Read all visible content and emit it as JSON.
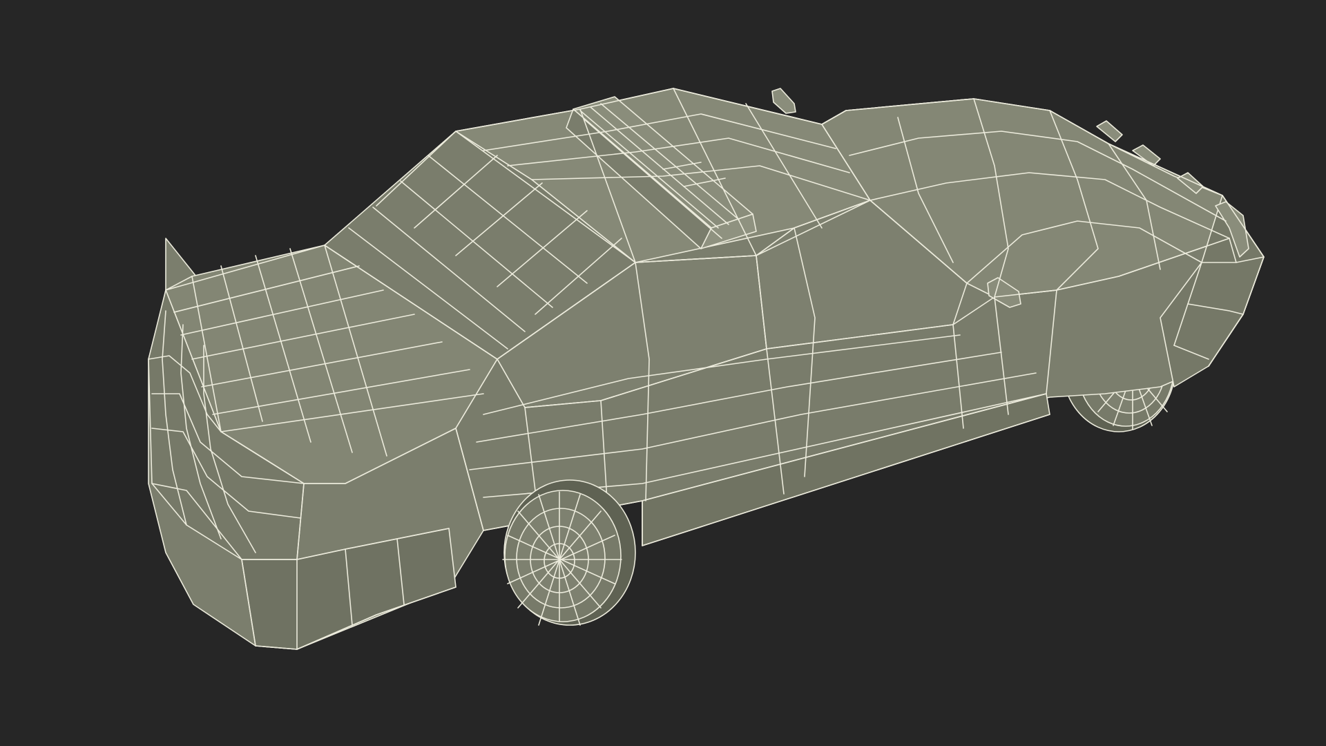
{
  "scene": {
    "subject": "car-wireframe-model",
    "colors": {
      "background": "#262626",
      "body": "#7e8170",
      "body_light": "#888b79",
      "body_dark": "#6b6e5e",
      "wire": "#ecebdc",
      "shadow": "#5f6253"
    }
  }
}
